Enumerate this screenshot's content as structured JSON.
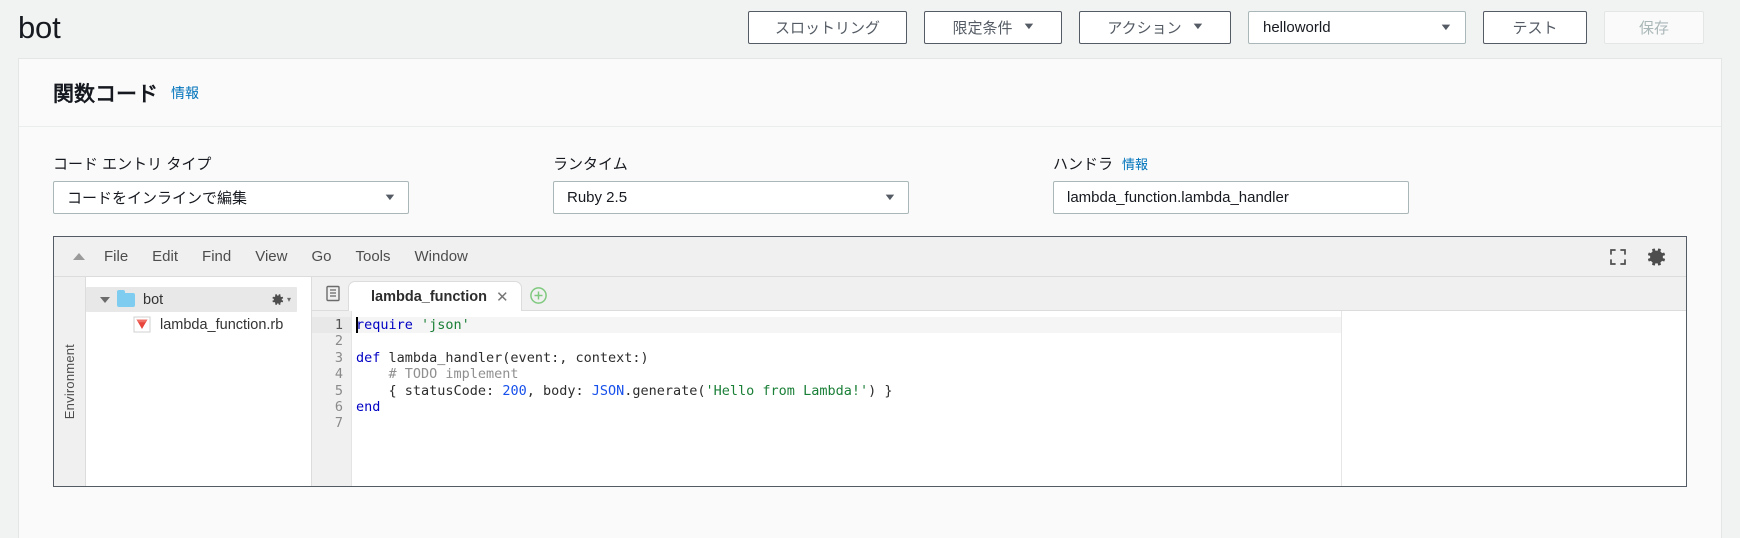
{
  "topbar": {
    "function_name": "bot",
    "throttle_label": "スロットリング",
    "qualifier_label": "限定条件",
    "actions_label": "アクション",
    "test_event": "helloworld",
    "test_label": "テスト",
    "save_label": "保存",
    "caret": "▼"
  },
  "panel": {
    "title": "関数コード",
    "info_label": "情報"
  },
  "form": {
    "code_entry": {
      "label": "コード エントリ タイプ",
      "value": "コードをインラインで編集"
    },
    "runtime": {
      "label": "ランタイム",
      "value": "Ruby 2.5"
    },
    "handler": {
      "label": "ハンドラ",
      "info_label": "情報",
      "value": "lambda_function.lambda_handler"
    }
  },
  "editor": {
    "menu": [
      "File",
      "Edit",
      "Find",
      "View",
      "Go",
      "Tools",
      "Window"
    ],
    "env_rail_label": "Environment",
    "tree": {
      "folder": "bot",
      "file": "lambda_function.rb"
    },
    "tab": {
      "title": "lambda_function",
      "close_glyph": "✕",
      "add_glyph": "+"
    },
    "gutter": [
      "1",
      "2",
      "3",
      "4",
      "5",
      "6",
      "7"
    ],
    "code": {
      "line1_kw": "require",
      "line1_str": "'json'",
      "line3_kw": "def",
      "line3_rest": " lambda_handler(event:, context:)",
      "line4_com": "    # TODO implement",
      "line5_a": "    { statusCode: ",
      "line5_num": "200",
      "line5_b": ", body: ",
      "line5_cls": "JSON",
      "line5_c": ".generate(",
      "line5_str": "'Hello from Lambda!'",
      "line5_d": ") }",
      "line6_kw": "end"
    }
  },
  "colors": {
    "accent_link": "#0073bb",
    "button_border": "#545b64",
    "page_bg": "#f1f3f3",
    "ruby_icon": "#e8453c",
    "folder_icon": "#7ecdf0"
  }
}
